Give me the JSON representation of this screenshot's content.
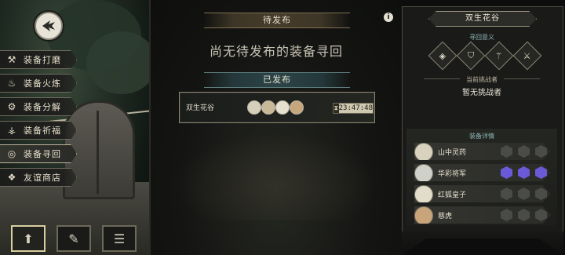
{
  "sidebar": {
    "back_icon": "back-arrow-icon",
    "items": [
      {
        "label": "装备打磨",
        "icon": "hammer-icon",
        "glyph": "⚒",
        "active": false
      },
      {
        "label": "装备火炼",
        "icon": "flame-icon",
        "glyph": "♨",
        "active": false
      },
      {
        "label": "装备分解",
        "icon": "gear-break-icon",
        "glyph": "⚙",
        "active": false
      },
      {
        "label": "装备祈福",
        "icon": "pray-icon",
        "glyph": "⚶",
        "active": false
      },
      {
        "label": "装备寻回",
        "icon": "compass-icon",
        "glyph": "◎",
        "active": true
      },
      {
        "label": "友谊商店",
        "icon": "fox-icon",
        "glyph": "❖",
        "active": false
      }
    ],
    "bottom_buttons": [
      {
        "icon": "upload-icon",
        "glyph": "⬆",
        "active": true
      },
      {
        "icon": "feather-icon",
        "glyph": "✎",
        "active": false
      },
      {
        "icon": "list-icon",
        "glyph": "☰",
        "active": false
      }
    ]
  },
  "center": {
    "pending_header": "待发布",
    "pending_empty": "尚无待发布的装备寻回",
    "published_header": "已发布",
    "published_item": {
      "region": "双生花谷",
      "timer": "23:47:48"
    }
  },
  "right": {
    "region_title": "双生花谷",
    "effects_label": "寻回意义",
    "effect_icons": [
      "shield-icon",
      "helm-icon",
      "scroll-icon",
      "sword-icon"
    ],
    "challenger_label": "当前挑战者",
    "challenger_value": "暂无挑战者",
    "gear_label": "装备详情",
    "gear_rows": [
      {
        "name": "山中灵药",
        "slots_lit": [
          false,
          false,
          false
        ]
      },
      {
        "name": "华彩将军",
        "slots_lit": [
          true,
          true,
          true
        ]
      },
      {
        "name": "红狐皇子",
        "slots_lit": [
          false,
          false,
          false
        ]
      },
      {
        "name": "慈虎",
        "slots_lit": [
          false,
          false,
          false
        ]
      }
    ]
  },
  "colors": {
    "accent_gold": "#8d8772",
    "slot_lit": "#6b5ad8",
    "timer_bg": "#cfc8b1"
  }
}
